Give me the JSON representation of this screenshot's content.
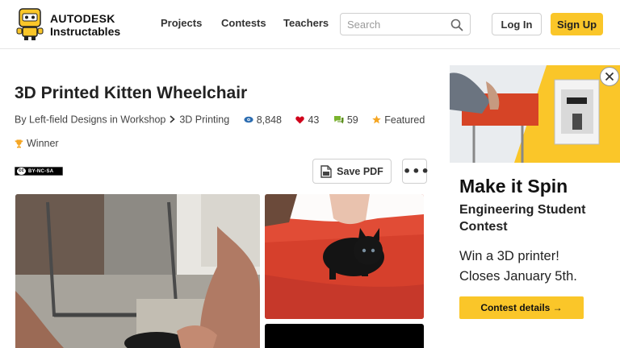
{
  "header": {
    "brand": "AUTODESK",
    "product": "Instructables",
    "nav": [
      {
        "label": "Projects"
      },
      {
        "label": "Contests"
      },
      {
        "label": "Teachers"
      }
    ],
    "search": {
      "placeholder": "Search"
    },
    "login_label": "Log In",
    "signup_label": "Sign Up"
  },
  "article": {
    "title": "3D Printed Kitten Wheelchair",
    "byline": "By Left-field Designs in Workshop",
    "category": "3D Printing",
    "views": "8,848",
    "favorites": "43",
    "comments": "59",
    "featured_label": "Featured",
    "winner_label": "Winner",
    "license": "BY-NC-SA",
    "save_pdf_label": "Save PDF",
    "more_label": "•••"
  },
  "ad": {
    "title": "Make it Spin",
    "subtitle": "Engineering Student Contest",
    "desc_line1": "Win a 3D printer!",
    "desc_line2": "Closes January 5th.",
    "button_label": "Contest details →"
  },
  "colors": {
    "accent": "#fac629",
    "view_icon": "#2b6cb0",
    "heart": "#d0021b",
    "comment": "#7ab32e",
    "star": "#f5a623"
  }
}
